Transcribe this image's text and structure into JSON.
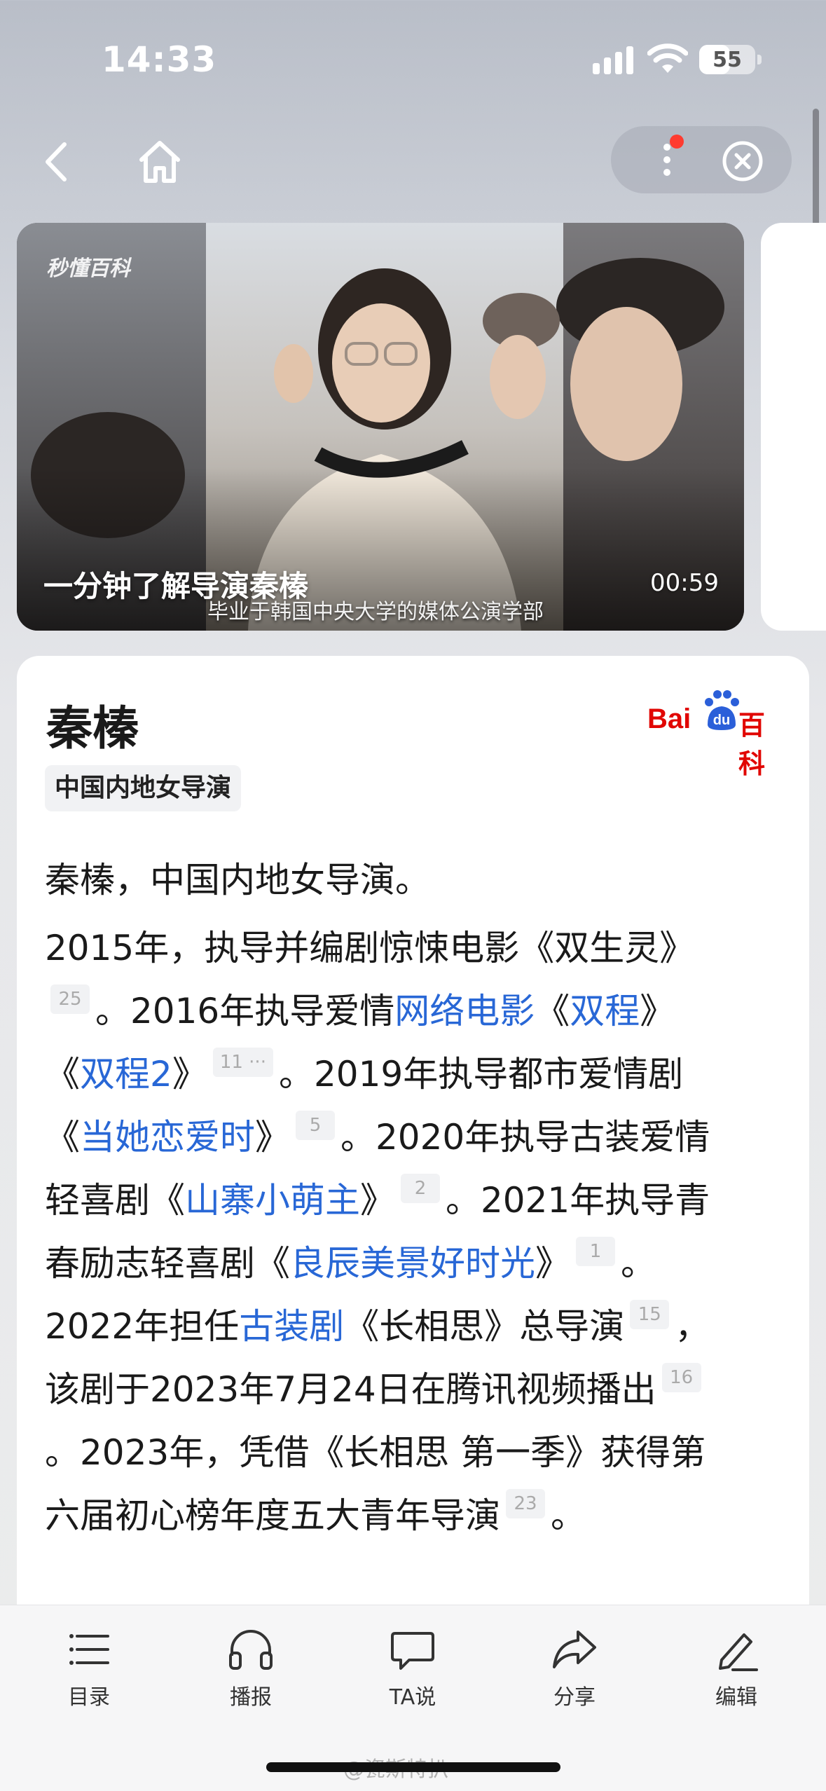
{
  "status_bar": {
    "time": "14:33",
    "battery": 55
  },
  "nav": {
    "back_icon": "chevron-left-icon",
    "home_icon": "home-icon",
    "more_icon": "more-vertical-icon",
    "close_icon": "close-circle-icon"
  },
  "video": {
    "watermark": "秒懂百科",
    "title": "一分钟了解导演秦榛",
    "subtitle": "毕业于韩国中央大学的媒体公演学部",
    "duration": "00:59"
  },
  "article": {
    "title": "秦榛",
    "logo": {
      "bai": "Bai",
      "du": "du",
      "baike": "百科"
    },
    "tag": "中国内地女导演",
    "summary": "秦榛，中国内地女导演。",
    "lines": [
      [
        {
          "t": "2015年，执导并编剧惊悚电影《双生灵》"
        }
      ],
      [
        {
          "ref": "25"
        },
        {
          "t": "。2016年执导爱情"
        },
        {
          "link": "网络电影"
        },
        {
          "t": "《"
        },
        {
          "link": "双程"
        },
        {
          "t": "》"
        }
      ],
      [
        {
          "t": "《"
        },
        {
          "link": "双程2"
        },
        {
          "t": "》"
        },
        {
          "ref": "11 ···"
        },
        {
          "t": "。2019年执导都市爱情剧"
        }
      ],
      [
        {
          "t": "《"
        },
        {
          "link": "当她恋爱时"
        },
        {
          "t": "》"
        },
        {
          "ref": "5"
        },
        {
          "t": "。2020年执导古装爱情"
        }
      ],
      [
        {
          "t": "轻喜剧《"
        },
        {
          "link": "山寨小萌主"
        },
        {
          "t": "》"
        },
        {
          "ref": "2"
        },
        {
          "t": "。2021年执导青"
        }
      ],
      [
        {
          "t": "春励志轻喜剧《"
        },
        {
          "link": "良辰美景好时光"
        },
        {
          "t": "》"
        },
        {
          "ref": "1"
        },
        {
          "t": "。"
        }
      ],
      [
        {
          "t": "2022年担任"
        },
        {
          "link": "古装剧"
        },
        {
          "t": "《长相思》总导演"
        },
        {
          "ref": "15"
        },
        {
          "t": "，"
        }
      ],
      [
        {
          "t": "该剧于2023年7月24日在腾讯视频播出"
        },
        {
          "ref": "16"
        }
      ],
      [
        {
          "t": "。2023年，凭借《长相思 第一季》获得第"
        }
      ],
      [
        {
          "t": "六届初心榜年度五大青年导演"
        },
        {
          "ref": "23"
        },
        {
          "t": "。"
        }
      ]
    ]
  },
  "toolbar": {
    "items": [
      {
        "label": "目录",
        "icon": "menu-list-icon"
      },
      {
        "label": "播报",
        "icon": "headphones-icon"
      },
      {
        "label": "TA说",
        "icon": "chat-bubble-icon"
      },
      {
        "label": "分享",
        "icon": "share-icon"
      },
      {
        "label": "编辑",
        "icon": "edit-pen-icon"
      }
    ]
  },
  "watermark": "@瓷斯特扒"
}
